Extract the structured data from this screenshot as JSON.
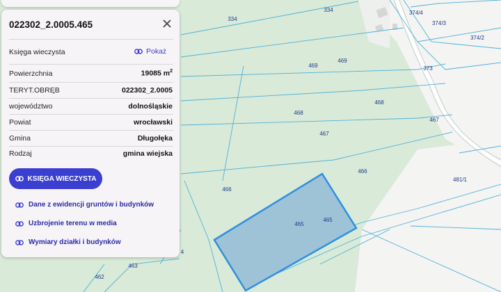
{
  "map": {
    "parcel_labels": [
      {
        "id": "334a",
        "text": "334"
      },
      {
        "id": "334b",
        "text": "334"
      },
      {
        "id": "374_4",
        "text": "374/4"
      },
      {
        "id": "374_3",
        "text": "374/3"
      },
      {
        "id": "374_2",
        "text": "374/2"
      },
      {
        "id": "373",
        "text": "373"
      },
      {
        "id": "469a",
        "text": "469"
      },
      {
        "id": "469b",
        "text": "469"
      },
      {
        "id": "468a",
        "text": "468"
      },
      {
        "id": "468b",
        "text": "468"
      },
      {
        "id": "467a",
        "text": "467"
      },
      {
        "id": "467b",
        "text": "467"
      },
      {
        "id": "466a",
        "text": "466"
      },
      {
        "id": "466b",
        "text": "466"
      },
      {
        "id": "481_1",
        "text": "481/1"
      },
      {
        "id": "465a",
        "text": "465"
      },
      {
        "id": "465b",
        "text": "465"
      },
      {
        "id": "463",
        "text": "463"
      },
      {
        "id": "462",
        "text": "462"
      },
      {
        "id": "4",
        "text": "4"
      }
    ],
    "colors": {
      "forest": "#d9ead8",
      "open": "#f4f4f2",
      "parcel_line": "#4fb0d8",
      "selected_fill": "#9ec3d6",
      "selected_stroke": "#2f8fe0"
    }
  },
  "panel": {
    "title": "022302_2.0005.465",
    "ksiega_label": "Księga wieczysta",
    "show_label": "Pokaż",
    "rows": [
      {
        "label": "Powierzchnia",
        "value": "19085 m",
        "unit_sup": "2"
      },
      {
        "label": "TERYT.OBRĘB",
        "value": "022302_2.0005"
      },
      {
        "label": "województwo",
        "value": "dolnośląskie"
      },
      {
        "label": "Powiat",
        "value": "wrocławski"
      },
      {
        "label": "Gmina",
        "value": "Długołęka"
      },
      {
        "label": "Rodzaj",
        "value": "gmina wiejska"
      }
    ],
    "button_label": "KSIĘGA WIECZYSTA",
    "links": [
      {
        "label": "Dane z ewidencji gruntów i budynków"
      },
      {
        "label": "Uzbrojenie terenu w media"
      },
      {
        "label": "Wymiary działki i budynków"
      }
    ],
    "accent": "#3b3fd0"
  }
}
